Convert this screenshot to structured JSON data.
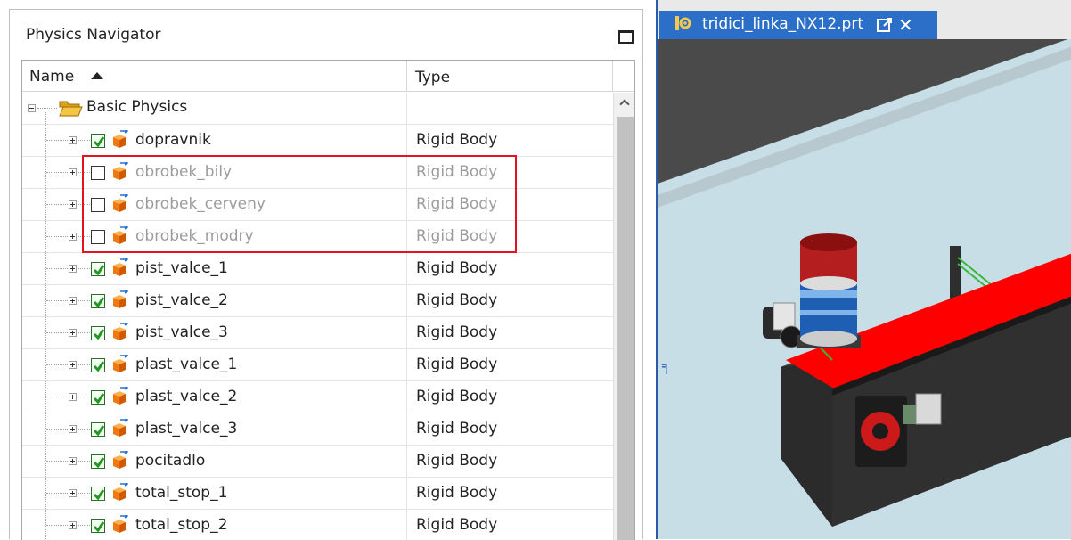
{
  "navigator": {
    "title": "Physics Navigator",
    "columns": {
      "name": "Name",
      "type": "Type"
    },
    "root": {
      "label": "Basic Physics"
    },
    "items": [
      {
        "label": "dopravnik",
        "type": "Rigid Body",
        "checked": true
      },
      {
        "label": "obrobek_bily",
        "type": "Rigid Body",
        "checked": false
      },
      {
        "label": "obrobek_cerveny",
        "type": "Rigid Body",
        "checked": false
      },
      {
        "label": "obrobek_modry",
        "type": "Rigid Body",
        "checked": false
      },
      {
        "label": "pist_valce_1",
        "type": "Rigid Body",
        "checked": true
      },
      {
        "label": "pist_valce_2",
        "type": "Rigid Body",
        "checked": true
      },
      {
        "label": "pist_valce_3",
        "type": "Rigid Body",
        "checked": true
      },
      {
        "label": "plast_valce_1",
        "type": "Rigid Body",
        "checked": true
      },
      {
        "label": "plast_valce_2",
        "type": "Rigid Body",
        "checked": true
      },
      {
        "label": "plast_valce_3",
        "type": "Rigid Body",
        "checked": true
      },
      {
        "label": "pocitadlo",
        "type": "Rigid Body",
        "checked": true
      },
      {
        "label": "total_stop_1",
        "type": "Rigid Body",
        "checked": true
      },
      {
        "label": "total_stop_2",
        "type": "Rigid Body",
        "checked": true
      }
    ]
  },
  "viewport": {
    "tab_title": "tridici_linka_NX12.prt",
    "close_glyph": "✕"
  },
  "colors": {
    "highlight": "#e0151f",
    "tab": "#2b6fc9",
    "check": "#1f9a1f",
    "cube": "#f07a12",
    "belt": "#ff0000"
  }
}
